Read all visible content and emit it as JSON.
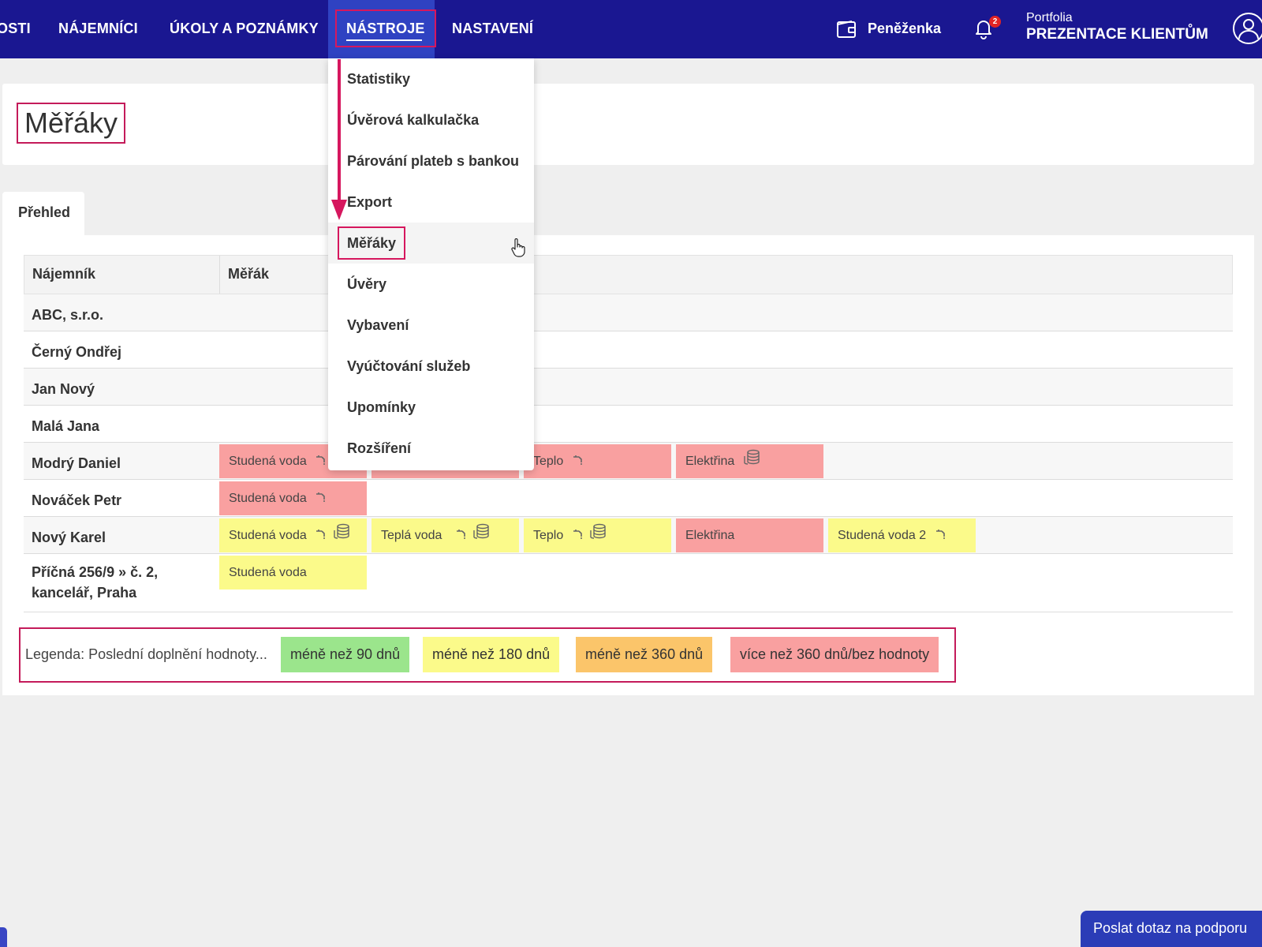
{
  "nav": {
    "items": [
      "OSTI",
      "NÁJEMNÍCI",
      "ÚKOLY A POZNÁMKY",
      "NÁSTROJE",
      "NASTAVENÍ"
    ],
    "wallet_label": "Peněženka",
    "notification_count": "2",
    "portfolio_sub": "Portfolia",
    "portfolio_name": "PREZENTACE KLIENTŮM"
  },
  "page": {
    "title": "Měřáky",
    "tab": "Přehled"
  },
  "table": {
    "headers": [
      "Nájemník",
      "Měřák"
    ],
    "rows": [
      {
        "name": "ABC, s.r.o."
      },
      {
        "name": "Černý Ondřej"
      },
      {
        "name": "Jan Nový"
      },
      {
        "name": "Malá Jana"
      },
      {
        "name": "Modrý Daniel",
        "meters": [
          {
            "label": "Studená voda",
            "color": "#f9a0a0",
            "icons": [
              "tap-icon"
            ]
          },
          {
            "label": "",
            "color": "#f9a0a0",
            "icons": []
          },
          {
            "label": "Teplo",
            "color": "#f9a0a0",
            "icons": [
              "tap-icon"
            ]
          },
          {
            "label": "Elektřina",
            "color": "#f9a0a0",
            "icons": [
              "coins-icon"
            ]
          }
        ]
      },
      {
        "name": "Nováček Petr",
        "meters": [
          {
            "label": "Studená voda",
            "color": "#f9a0a0",
            "icons": [
              "tap-icon"
            ]
          }
        ]
      },
      {
        "name": "Nový Karel",
        "meters": [
          {
            "label": "Studená voda",
            "color": "#fbfa8a",
            "icons": [
              "tap-icon",
              "coins-icon"
            ]
          },
          {
            "label": "Teplá voda",
            "color": "#fbfa8a",
            "icons": [
              "tap-icon",
              "coins-icon"
            ]
          },
          {
            "label": "Teplo",
            "color": "#fbfa8a",
            "icons": [
              "tap-icon",
              "coins-icon"
            ]
          },
          {
            "label": "Elektřina",
            "color": "#f9a0a0",
            "icons": []
          },
          {
            "label": "Studená voda 2",
            "color": "#fbfa8a",
            "icons": [
              "tap-icon"
            ]
          }
        ]
      },
      {
        "name_line1": "Příčná 256/9 » č. 2,",
        "name_line2": "kancelář, Praha",
        "meters": [
          {
            "label": "Studená voda",
            "color": "#fbfa8a",
            "icons": []
          }
        ]
      }
    ]
  },
  "legend": {
    "label": "Legenda: Poslední doplnění hodnoty...",
    "items": [
      {
        "label": "méně než 90 dnů",
        "color": "#9be58c"
      },
      {
        "label": "méně než 180 dnů",
        "color": "#fbfa8a"
      },
      {
        "label": "méně než 360 dnů",
        "color": "#fbc56a"
      },
      {
        "label": "více než 360 dnů/bez hodnoty",
        "color": "#f9a0a0"
      }
    ]
  },
  "dropdown": {
    "items": [
      "Statistiky",
      "Úvěrová kalkulačka",
      "Párování plateb s bankou",
      "Export",
      "Měřáky",
      "Úvěry",
      "Vybavení",
      "Vyúčtování služeb",
      "Upomínky",
      "Rozšíření"
    ],
    "hovered": "Měřáky"
  },
  "support": {
    "label": "Poslat dotaz na podporu"
  },
  "colors": {
    "nav_bg": "#1a1791",
    "nav_active": "#2f42c2",
    "highlight": "#d6175e"
  }
}
